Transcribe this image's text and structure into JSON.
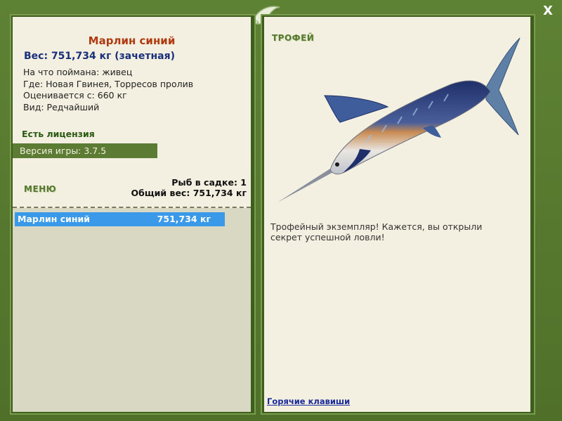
{
  "window": {
    "close_label": "X"
  },
  "fish": {
    "name": "Марлин синий",
    "weight_line": "Вес: 751,734 кг (зачетная)",
    "info": [
      "На что поймана: живец",
      "Где: Новая Гвинея, Торресов пролив",
      "Оценивается с: 660 кг",
      "Вид: Редчайший"
    ]
  },
  "license": "Есть лицензия",
  "version": "Версия игры: 3.7.5",
  "menu_label": "МЕНЮ",
  "keepnet": {
    "count_line": "Рыб в садке: 1",
    "total_line": "Общий вес: 751,734 кг"
  },
  "catch_list": [
    {
      "name": "Марлин синий",
      "weight": "751,734 кг"
    }
  ],
  "trophy": {
    "label": "ТРОФЕЙ",
    "text": "Трофейный экземпляр! Кажется, вы открыли секрет успешной ловли!"
  },
  "hotkeys_label": "Горячие клавиши",
  "colors": {
    "frame": "#56782f",
    "panel": "#f3f0e1",
    "title": "#b03a10",
    "weight": "#1a2f7a",
    "selection": "#3a99e8"
  },
  "icons": {
    "logo": "fish-logo-icon",
    "fish_image": "blue-marlin-illustration"
  }
}
